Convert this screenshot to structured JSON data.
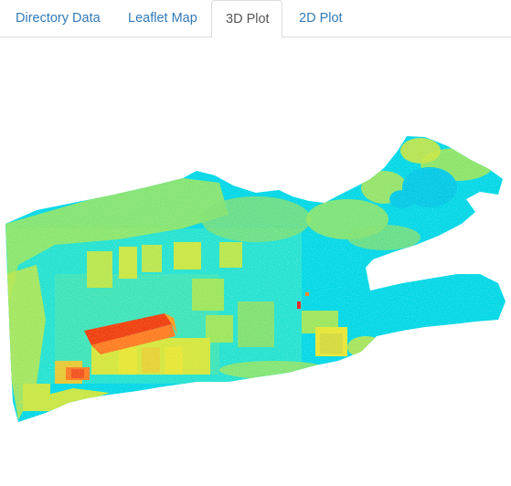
{
  "tabs": [
    {
      "label": "Directory Data",
      "active": false
    },
    {
      "label": "Leaflet Map",
      "active": false
    },
    {
      "label": "3D Plot",
      "active": true
    },
    {
      "label": "2D Plot",
      "active": false
    }
  ],
  "plot": {
    "type": "3d-point-cloud",
    "colormap": "jet",
    "colors": {
      "low": "#00c8e6",
      "mid_low": "#2ee6c8",
      "mid": "#9be65a",
      "mid_high": "#e6e632",
      "high": "#ff9a1e",
      "peak": "#f03c0a"
    }
  }
}
